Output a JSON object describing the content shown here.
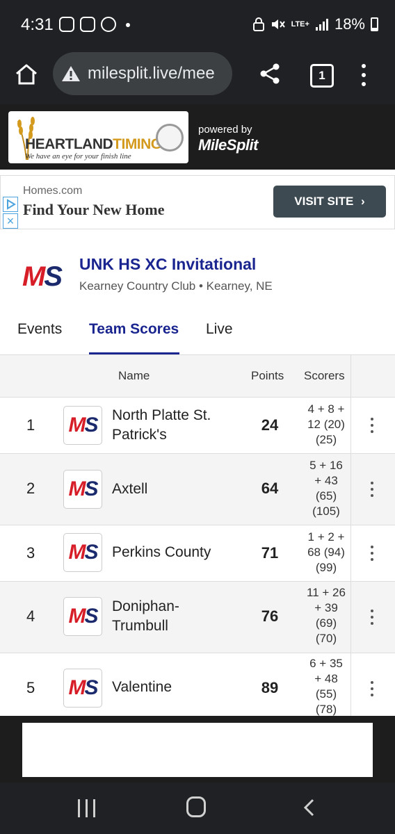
{
  "status_bar": {
    "time": "4:31",
    "network": "LTE+",
    "battery": "18%"
  },
  "browser": {
    "url": "milesplit.live/mee",
    "tab_count": "1"
  },
  "header": {
    "brand_heartland": "HEARTLAND",
    "brand_timing": "TIMING",
    "tagline": "We have an eye for your finish line",
    "powered_by": "powered by",
    "milesplit": "MileSplit"
  },
  "ad": {
    "domain": "Homes.com",
    "headline": "Find Your New Home",
    "cta": "VISIT SITE"
  },
  "meet": {
    "logo_m": "M",
    "logo_s": "S",
    "title": "UNK HS XC Invitational",
    "location": "Kearney Country Club • Kearney, NE"
  },
  "tabs": [
    {
      "label": "Events"
    },
    {
      "label": "Team Scores"
    },
    {
      "label": "Live"
    }
  ],
  "table": {
    "headers": {
      "name": "Name",
      "points": "Points",
      "scorers": "Scorers"
    },
    "rows": [
      {
        "rank": "1",
        "team_line1": "North Platte St.",
        "team_line2": "Patrick's",
        "points": "24",
        "scorers": [
          "4 + 8 +",
          "12 (20)",
          "(25)"
        ]
      },
      {
        "rank": "2",
        "team_line1": "Axtell",
        "team_line2": "",
        "points": "64",
        "scorers": [
          "5 + 16",
          "+ 43",
          "(65)",
          "(105)"
        ]
      },
      {
        "rank": "3",
        "team_line1": "Perkins County",
        "team_line2": "",
        "points": "71",
        "scorers": [
          "1 + 2 +",
          "68 (94)",
          "(99)"
        ]
      },
      {
        "rank": "4",
        "team_line1": "Doniphan-",
        "team_line2": "Trumbull",
        "points": "76",
        "scorers": [
          "11 + 26",
          "+ 39",
          "(69)",
          "(70)"
        ]
      },
      {
        "rank": "5",
        "team_line1": "Valentine",
        "team_line2": "",
        "points": "89",
        "scorers": [
          "6 + 35",
          "+ 48",
          "(55)",
          "(78)"
        ]
      }
    ]
  },
  "colors": {
    "accent_blue": "#1a2590",
    "ms_red": "#d71e28",
    "ms_navy": "#1a2a6c",
    "gold": "#d49a1e"
  }
}
